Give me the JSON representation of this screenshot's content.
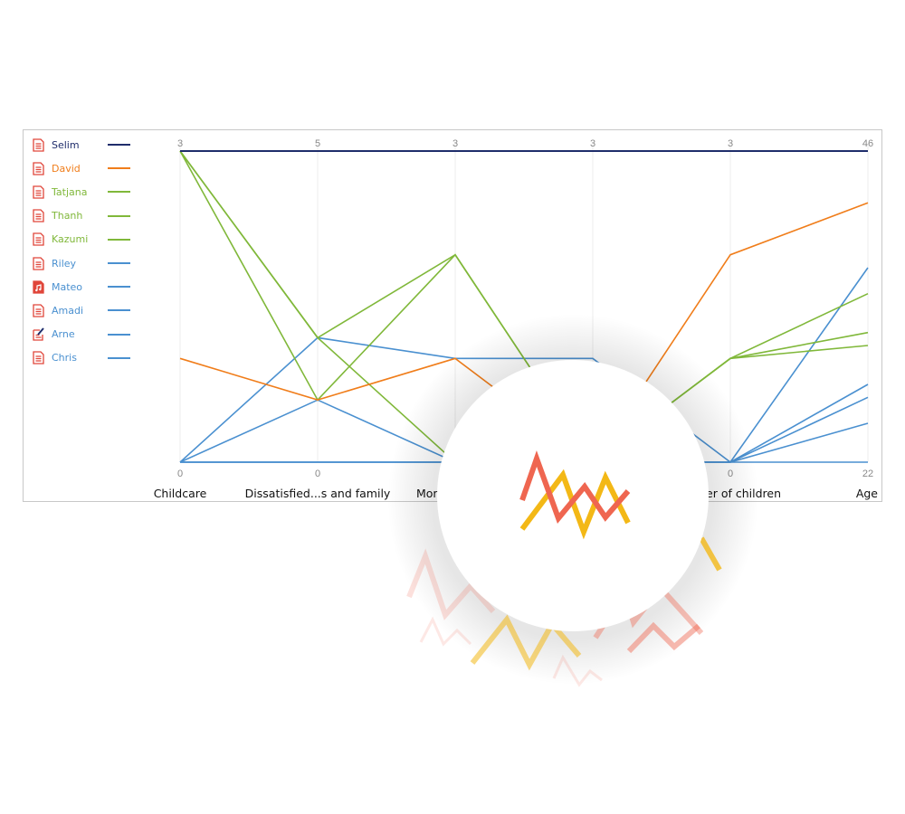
{
  "chart_data": {
    "type": "parallel-coordinates",
    "axes": [
      {
        "label": "Childcare",
        "min": 0,
        "max": 3,
        "min_label": "0",
        "max_label": "3"
      },
      {
        "label": "Dissatisfied...s and family",
        "min": 0,
        "max": 5,
        "min_label": "0",
        "max_label": "5"
      },
      {
        "label": "Mor",
        "min": 0,
        "max": 3,
        "min_label": null,
        "max_label": "3"
      },
      {
        "label": "",
        "min": 0,
        "max": 3,
        "min_label": null,
        "max_label": "3"
      },
      {
        "label": "ber of children",
        "min": 0,
        "max": 3,
        "min_label": "0",
        "max_label": "3"
      },
      {
        "label": "Age",
        "min": 22,
        "max": 46,
        "min_label": "22",
        "max_label": "46"
      }
    ],
    "series": [
      {
        "name": "Selim",
        "color": "#1f2d6b",
        "icon": "document-icon",
        "values": [
          3,
          5,
          3,
          3,
          3,
          46
        ]
      },
      {
        "name": "David",
        "color": "#f07d1a",
        "icon": "document-icon",
        "values": [
          1,
          1,
          1,
          0,
          2,
          42
        ]
      },
      {
        "name": "Tatjana",
        "color": "#80b83a",
        "icon": "document-icon",
        "values": [
          3,
          2,
          2,
          0,
          1,
          35
        ]
      },
      {
        "name": "Thanh",
        "color": "#80b83a",
        "icon": "document-icon",
        "values": [
          3,
          1,
          2,
          0,
          1,
          32
        ]
      },
      {
        "name": "Kazumi",
        "color": "#80b83a",
        "icon": "document-icon",
        "values": [
          3,
          2,
          0,
          0,
          1,
          31
        ]
      },
      {
        "name": "Riley",
        "color": "#4a90d0",
        "icon": "document-icon",
        "values": [
          0,
          2,
          1,
          1,
          0,
          37
        ]
      },
      {
        "name": "Mateo",
        "color": "#4a90d0",
        "icon": "music-file-icon",
        "values": [
          0,
          1,
          0,
          0,
          0,
          28
        ]
      },
      {
        "name": "Amadi",
        "color": "#4a90d0",
        "icon": "document-icon",
        "values": [
          0,
          0,
          0,
          0,
          0,
          27
        ]
      },
      {
        "name": "Arne",
        "color": "#4a90d0",
        "icon": "edit-document-icon",
        "values": [
          0,
          0,
          0,
          0,
          0,
          25
        ]
      },
      {
        "name": "Chris",
        "color": "#4a90d0",
        "icon": "document-icon",
        "values": [
          0,
          0,
          0,
          0,
          0,
          22
        ]
      }
    ],
    "legend": "left",
    "grid": true
  },
  "colors": {
    "icon": "#e0463a",
    "logo_red": "#ef6650",
    "logo_yellow": "#f3b816"
  }
}
